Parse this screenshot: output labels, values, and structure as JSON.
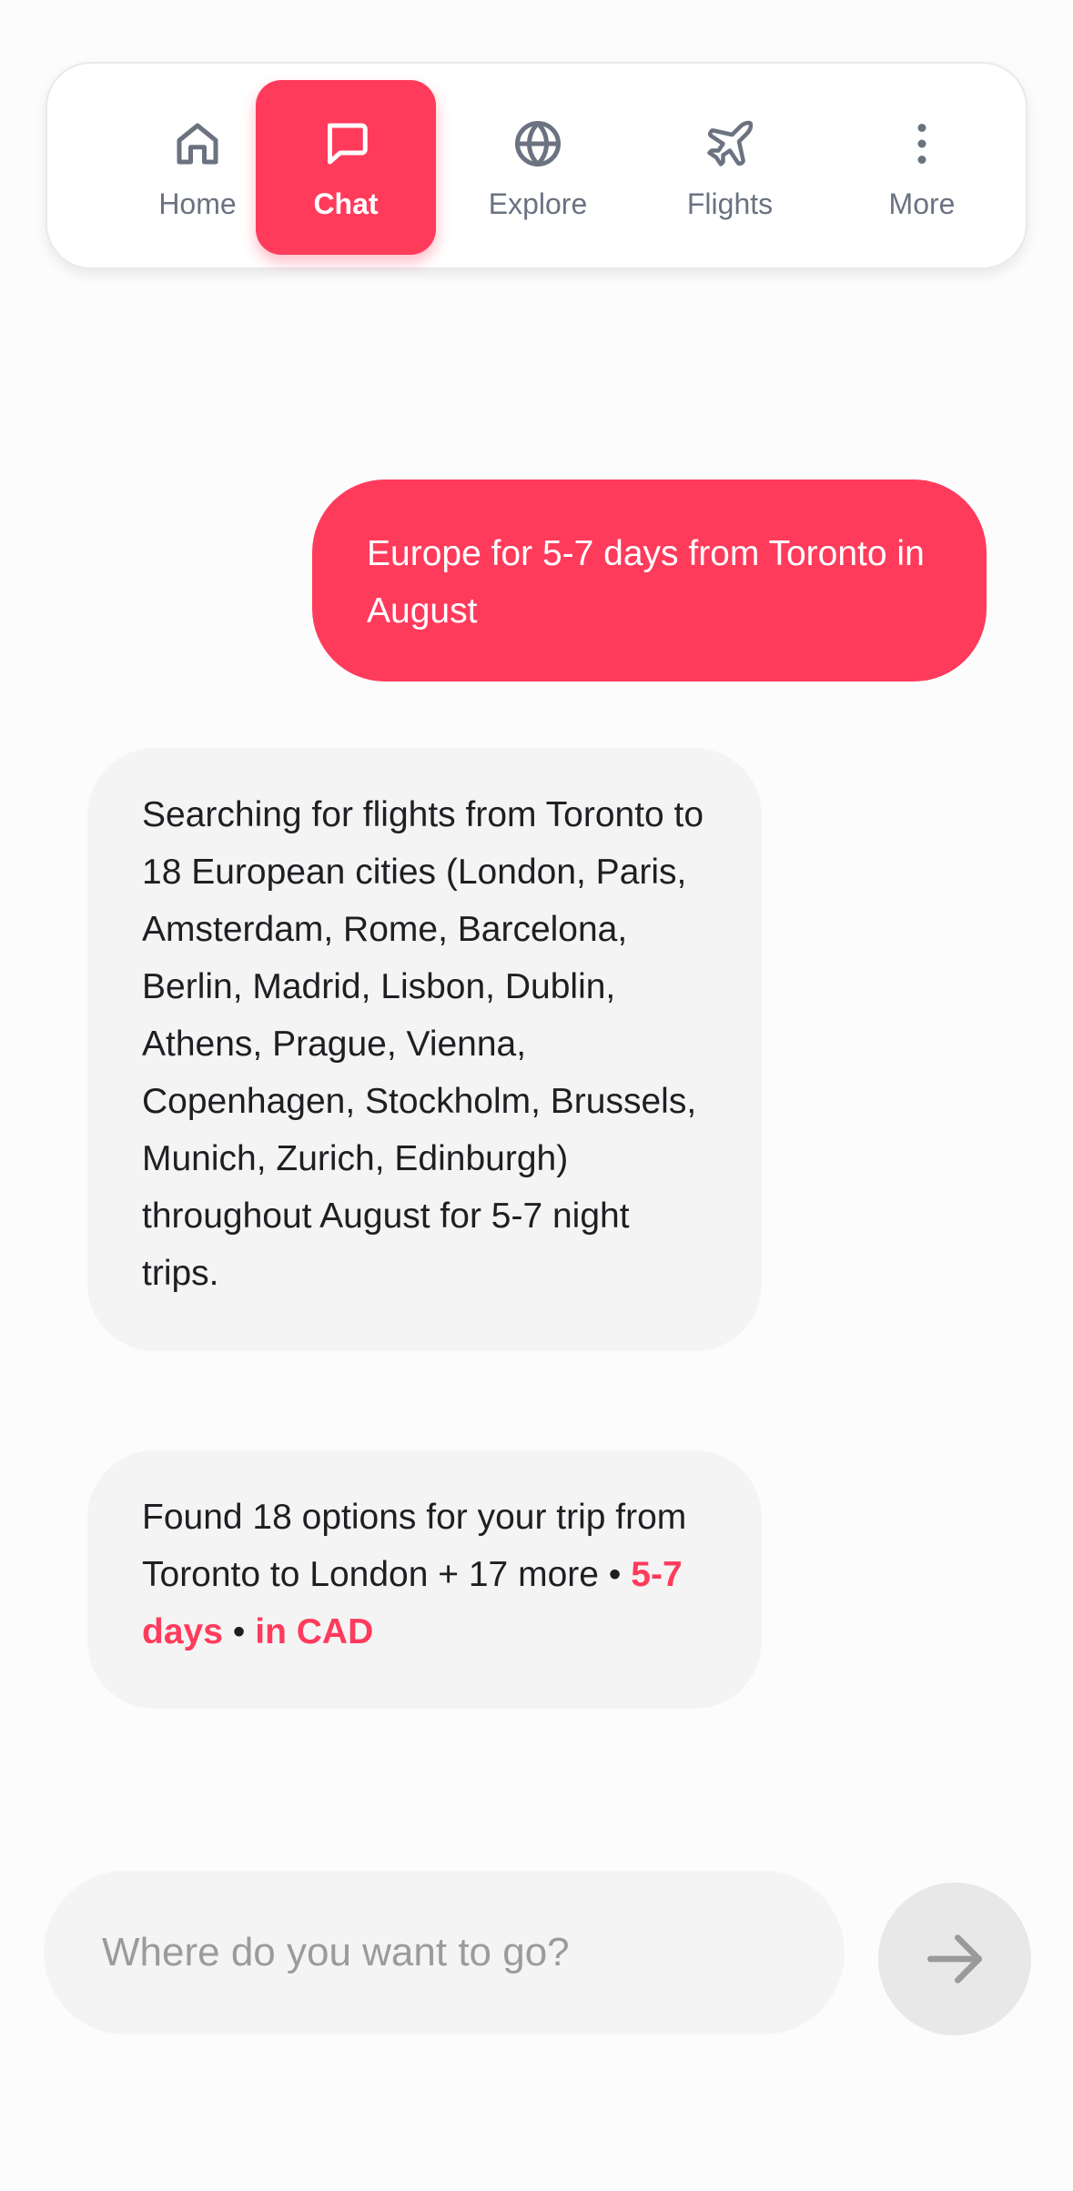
{
  "nav": {
    "items": [
      {
        "label": "Home",
        "icon": "home-icon"
      },
      {
        "label": "Chat",
        "icon": "chat-bubble-icon",
        "active": true
      },
      {
        "label": "Explore",
        "icon": "globe-icon"
      },
      {
        "label": "Flights",
        "icon": "plane-icon"
      },
      {
        "label": "More",
        "icon": "more-vertical-icon"
      }
    ]
  },
  "chat": {
    "user_message": "Europe for 5-7 days from Toronto in August",
    "bot_message_1": "Searching for flights from Toronto to 18 European cities (London, Paris, Amsterdam, Rome, Barcelona, Berlin, Madrid, Lisbon, Dublin, Athens, Prague, Vienna, Copenhagen, Stockholm, Brussels, Munich, Zurich, Edinburgh) throughout August for 5-7 night trips.",
    "bot_message_2": {
      "text": "Found 18 options for your trip from Toronto to London + 17 more",
      "separator": "•",
      "duration": "5-7 days",
      "currency": "in CAD"
    }
  },
  "composer": {
    "placeholder": "Where do you want to go?",
    "value": "",
    "send_icon": "arrow-right-icon"
  },
  "colors": {
    "accent": "#ff3b5c",
    "nav_inactive": "#6b7280",
    "bubble_bg": "#f4f4f5",
    "send_bg": "#e8e8e8"
  }
}
